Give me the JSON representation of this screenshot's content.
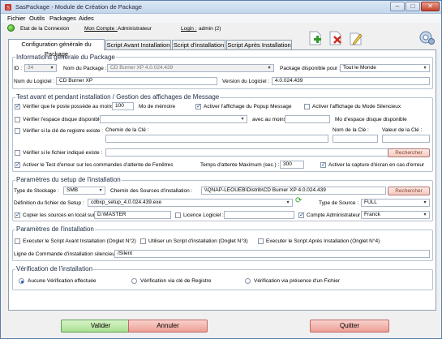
{
  "window": {
    "title": "SasPackage - Module de Création de Package"
  },
  "menu": [
    "Fichier",
    "Outils",
    "Packages",
    "Aides"
  ],
  "status": {
    "server_label": "Etat de la Connexion",
    "user_label": "Mon Compte :",
    "user_value": "Administrateur",
    "login_label": "Login :",
    "login_value": "admin (2)"
  },
  "toolbar": {
    "add": "add-package",
    "delete": "delete-package",
    "edit": "edit-package",
    "settings": "settings"
  },
  "tabs": [
    "Configuration générale du Package",
    "Script Avant Installation",
    "Script d'installation",
    "Script Après Installation"
  ],
  "general": {
    "title": "Informations générale du Package",
    "id_label": "ID :",
    "id_value": "34",
    "name_label": "Nom du Package :",
    "name_value": "CD Burner XP 4.0.024.439",
    "avail_label": "Package disponible pour :",
    "avail_value": "Tout le Monde",
    "software_label": "Nom du Logiciel :",
    "software_value": "CD Burner XP",
    "version_label": "Version du Logiciel :",
    "version_value": "4.0.024.439"
  },
  "test": {
    "title": "Test avant et pendant installation / Gestion des affichages de Message",
    "check_post": "Vérifier que le poste possède au moins :",
    "memory_value": "100",
    "memory_unit": "Mo de mémoire",
    "popup": "Activer l'affichage du Popup Message",
    "silent": "Activer l'affichage du Mode Silencieux",
    "disk_space": "Vérifier l'espace disque disponible sur :",
    "with_at_least": "avec au moins",
    "disk_unit": "Mo d'espace disque disponible",
    "reg_key": "Vérifier si la clé de registre existe :",
    "key_path": "Chemin de la Clé :",
    "key_name": "Nom de la Clé :",
    "key_value": "Valeur de la Clé :",
    "file_exists": "Vérifier si le fichier indiqué existe :",
    "search": "Rechercher",
    "end_test": "Activer le Test d'erreur sur les commandes d'attente de Fenêtres",
    "wait_label": "Temps d'attente Maximum (sec.) :",
    "wait_value": "300",
    "capture": "Activer la capture d'écran en cas d'erreur"
  },
  "setup": {
    "title": "Paramètres du setup de l'installation",
    "storage_label": "Type de Stockage :",
    "storage_value": "SMB",
    "path_label": "Chemin des Sources d'installation :",
    "path_value": "\\\\QNAP-LEOUEB\\Distrib\\CD Burner XP 4.0.024.439",
    "search": "Rechercher",
    "setup_def_label": "Définition du fichier de Setup :",
    "setup_file": "cdbxp_setup_4.0.024.439.exe",
    "source_type_label": "Type de Source :",
    "source_type_value": "FULL",
    "copy_local": "Copier les sources en local sur :",
    "local_path": "D:\\MASTER",
    "license": "Licence Logiciel :",
    "admin_account": "Compte Administrateur :",
    "language": "Franck"
  },
  "install": {
    "title": "Paramètres de l'installation",
    "before": "Executer le Script Avant Installation (Onglet N°2)",
    "use": "Utiliser un Script d'installation (Onglet N°3)",
    "after": "Executer le Script Après Installation (Onglet N°4)",
    "cmd_label": "Ligne de Commande d'installation silencieuse :",
    "cmd_value": "/Silent"
  },
  "verify": {
    "title": "Vérification de l'installation",
    "none": "Aucune Vérification effectuée",
    "registry": "Vérification via clé de Registre",
    "file": "Vérification via présence d'un Fichier"
  },
  "buttons": {
    "ok": "Valider",
    "cancel": "Annuler",
    "quit": "Quitter"
  },
  "colors": {
    "ok": "#a9e08e",
    "cancel": "#ec9e93",
    "search": "#f3c9bf"
  }
}
